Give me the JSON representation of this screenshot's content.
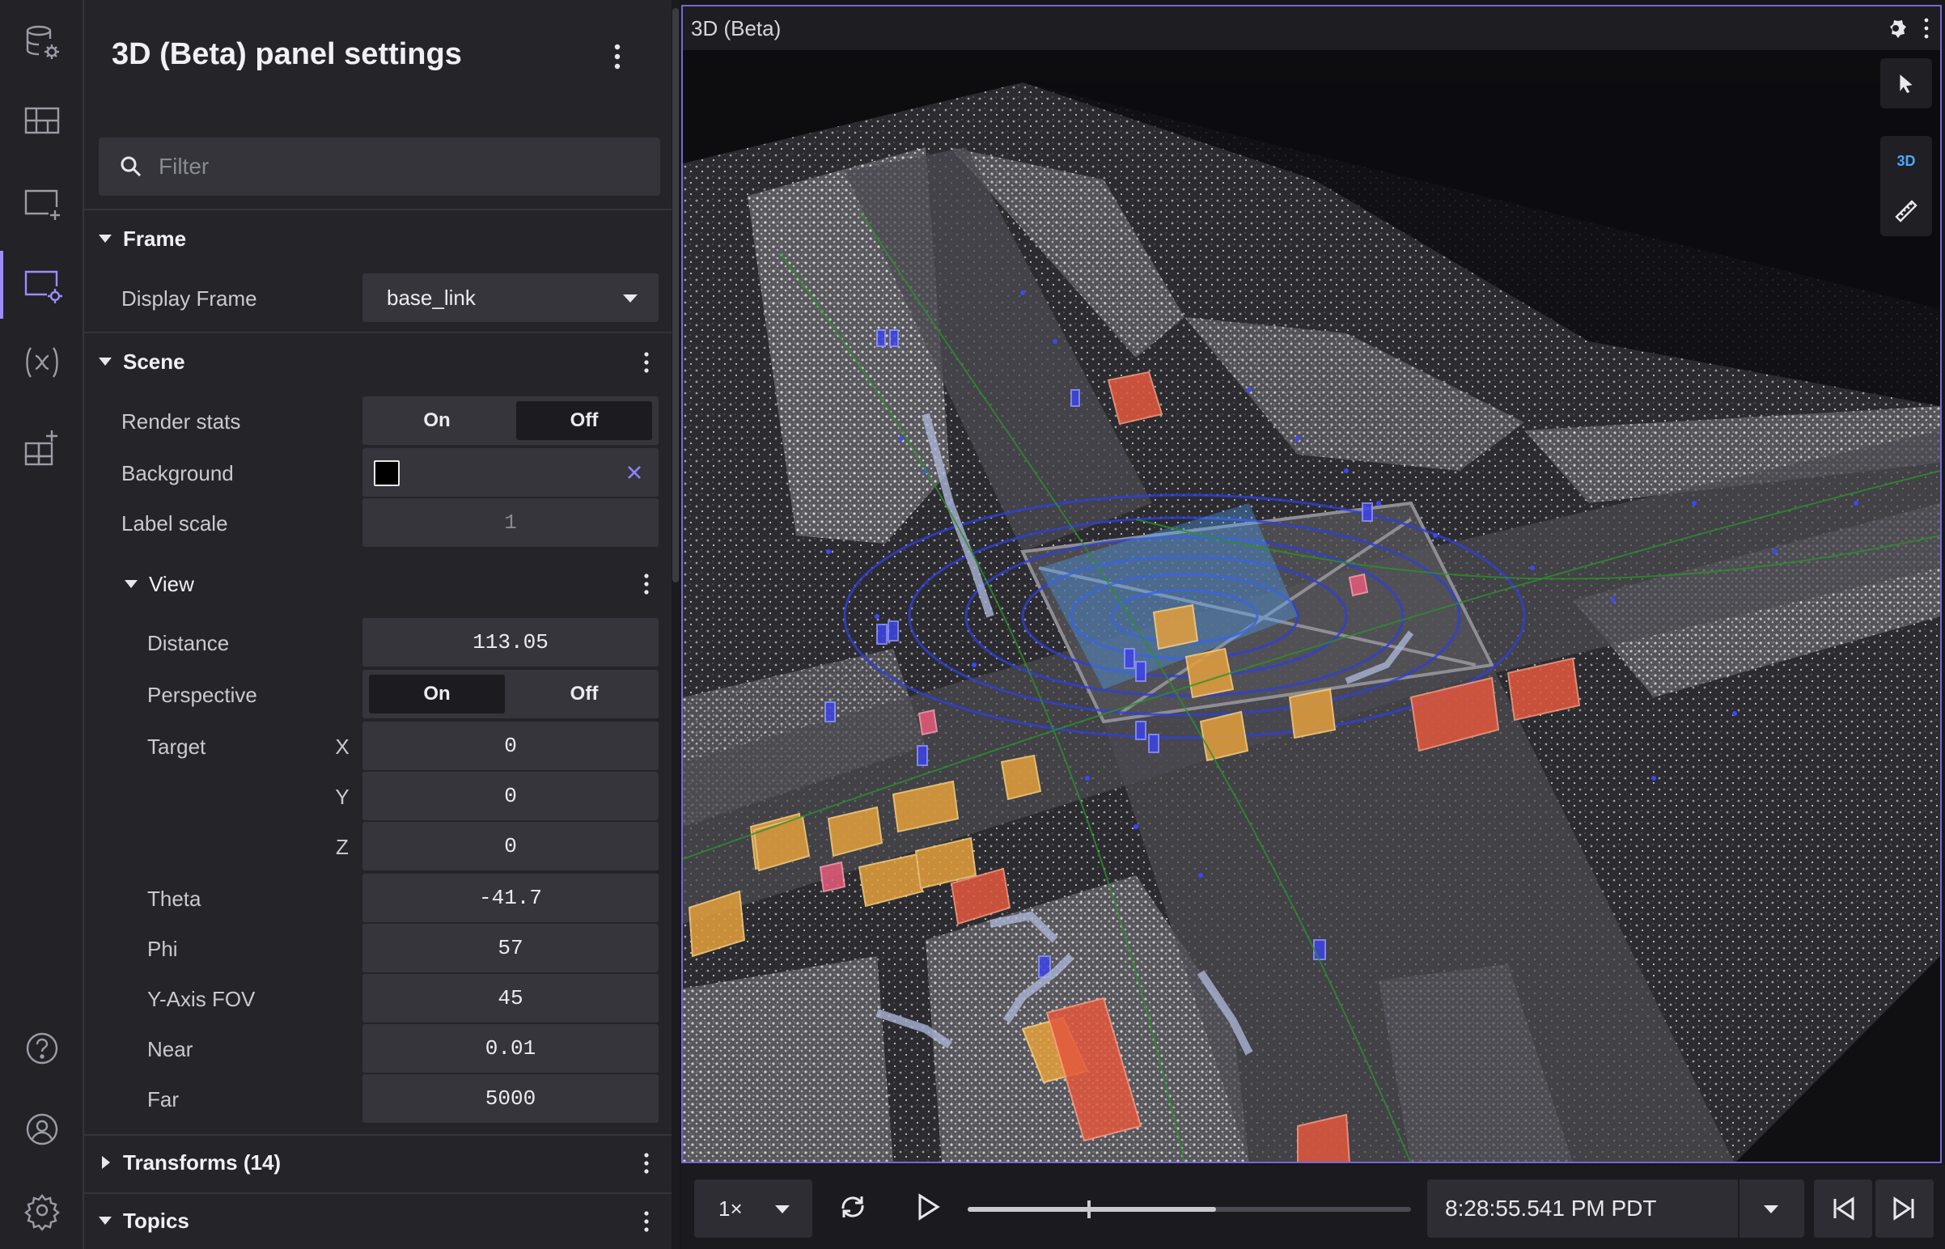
{
  "rail": {
    "items": [
      {
        "name": "data-source-icon"
      },
      {
        "name": "layouts-icon"
      },
      {
        "name": "add-panel-icon"
      },
      {
        "name": "panel-settings-icon",
        "active": true
      },
      {
        "name": "variables-icon"
      },
      {
        "name": "extensions-icon"
      },
      {
        "name": "help-icon"
      },
      {
        "name": "account-icon"
      },
      {
        "name": "app-settings-icon"
      }
    ]
  },
  "settings": {
    "title": "3D (Beta) panel settings",
    "filter_placeholder": "Filter",
    "frame": {
      "heading": "Frame",
      "display_frame_label": "Display Frame",
      "display_frame_value": "base_link"
    },
    "scene": {
      "heading": "Scene",
      "render_stats_label": "Render stats",
      "render_stats_on": "On",
      "render_stats_off": "Off",
      "render_stats_selected": "Off",
      "background_label": "Background",
      "background_color": "#000000",
      "label_scale_label": "Label scale",
      "label_scale_placeholder": "1"
    },
    "view": {
      "heading": "View",
      "distance_label": "Distance",
      "distance_value": "113.05",
      "perspective_label": "Perspective",
      "perspective_on": "On",
      "perspective_off": "Off",
      "perspective_selected": "On",
      "target_label": "Target",
      "target_x_label": "X",
      "target_x": "0",
      "target_y_label": "Y",
      "target_y": "0",
      "target_z_label": "Z",
      "target_z": "0",
      "theta_label": "Theta",
      "theta_value": "-41.7",
      "phi_label": "Phi",
      "phi_value": "57",
      "fov_label": "Y-Axis FOV",
      "fov_value": "45",
      "near_label": "Near",
      "near_value": "0.01",
      "far_label": "Far",
      "far_value": "5000"
    },
    "transforms": {
      "heading": "Transforms (14)"
    },
    "topics": {
      "heading": "Topics"
    }
  },
  "viewport": {
    "title": "3D (Beta)",
    "tools": {
      "select": "cursor-icon",
      "mode_label": "3D",
      "measure": "ruler-icon"
    },
    "colors": {
      "frame_border": "#7668d6",
      "car_box": "#e5a03c",
      "truck_box": "#e4583d",
      "ped_box": "#3d44e6",
      "bike_box": "#e65a7a",
      "barrier_box": "#aab4d6"
    }
  },
  "playback": {
    "speed": "1×",
    "progress_fraction": 0.56,
    "marker_fraction": 0.27,
    "time": "8:28:55.541 PM PDT"
  }
}
